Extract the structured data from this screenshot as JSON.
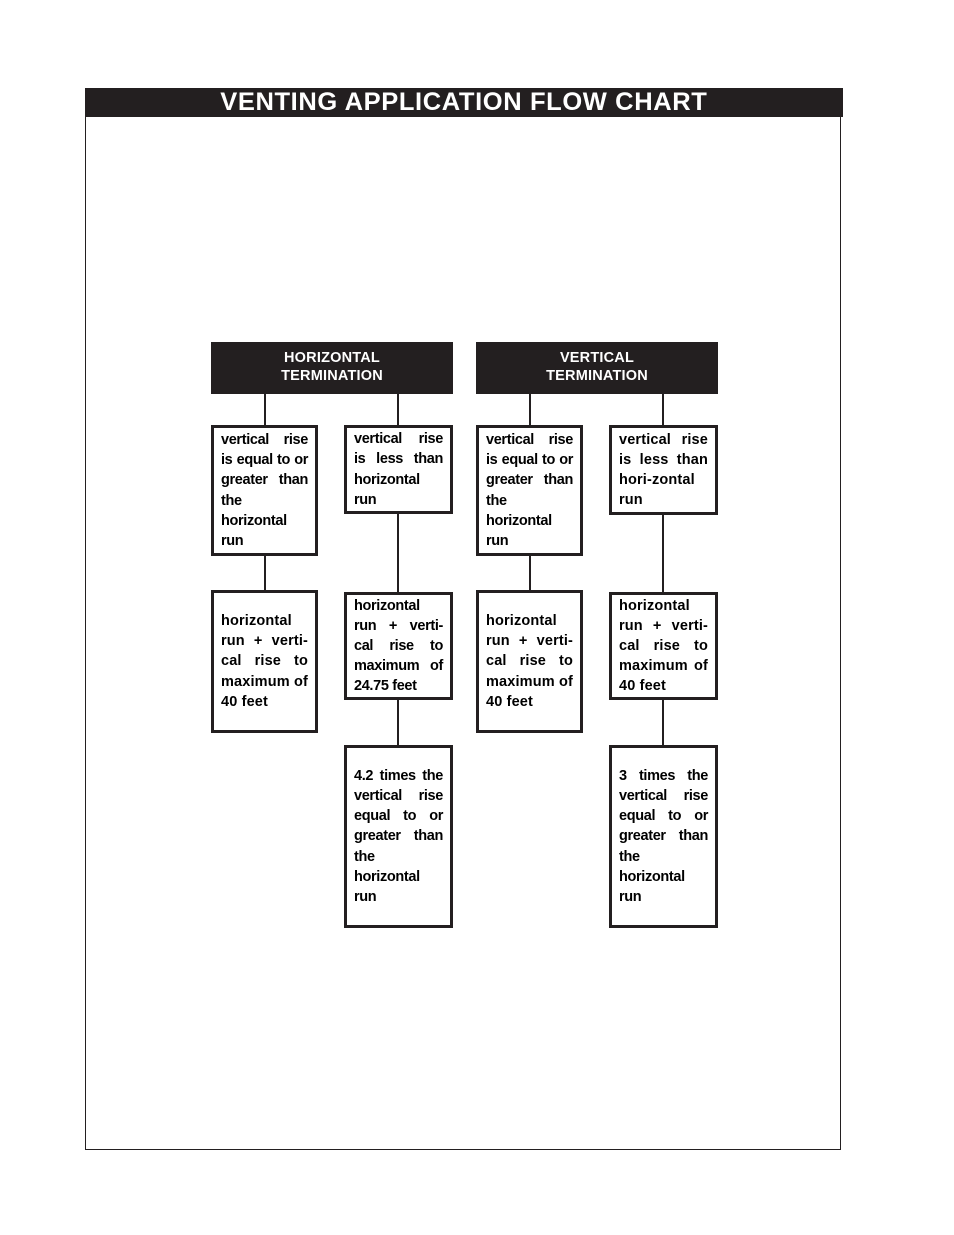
{
  "page": {
    "title": "VENTING APPLICATION FLOW CHART"
  },
  "chart_data": {
    "type": "diagram",
    "title": "VENTING APPLICATION FLOW CHART",
    "groups": [
      {
        "id": "horizontal-termination",
        "label": "HORIZONTAL\nTERMINATION",
        "branches": [
          {
            "id": "h-equal-or-greater",
            "condition": "vertical rise is equal to or greater than the horizontal run",
            "steps": [
              "horizontal run + vertical rise to maximum of 40 feet"
            ]
          },
          {
            "id": "h-less-than",
            "condition": "vertical rise is less than horizontal run",
            "steps": [
              "horizontal run + vertical rise to maximum of 24.75 feet",
              "4.2 times the vertical rise equal to or greater than the horizontal run"
            ]
          }
        ]
      },
      {
        "id": "vertical-termination",
        "label": "VERTICAL\nTERMINATION",
        "branches": [
          {
            "id": "v-equal-or-greater",
            "condition": "vertical rise is equal to or greater than the horizontal run",
            "steps": [
              "horizontal run + vertical rise to maximum of 40 feet"
            ]
          },
          {
            "id": "v-less-than",
            "condition": "vertical rise is less than horizontal run",
            "steps": [
              "horizontal run + vertical rise to maximum of 40 feet",
              "3 times the vertical rise equal to or greater than the horizontal run"
            ]
          }
        ]
      }
    ]
  },
  "headers": {
    "horizontal": {
      "line1": "HORIZONTAL",
      "line2": "TERMINATION"
    },
    "vertical": {
      "line1": "VERTICAL",
      "line2": "TERMINATION"
    }
  },
  "boxes": {
    "col1_row1": "vertical rise is equal to or greater than the horizontal run",
    "col2_row1": "vertical rise is less than horizontal run",
    "col3_row1": "vertical rise is equal to or greater than the horizontal run",
    "col4_row1": "vertical rise is less than hori-zontal run",
    "col1_row2": "horizontal run + verti-cal rise to maximum of 40 feet",
    "col2_row2": "horizontal run + verti-cal rise to maximum of 24.75 feet",
    "col3_row2": "horizontal run + verti-cal rise to maximum of 40 feet",
    "col4_row2": "horizontal run + verti-cal rise to maximum of 40 feet",
    "col2_row3": "4.2 times the vertical rise equal to or greater than the horizontal run",
    "col4_row3": "3 times the vertical rise equal to or greater than the horizontal run"
  },
  "colors": {
    "ink": "#231f20",
    "paper": "#ffffff"
  }
}
